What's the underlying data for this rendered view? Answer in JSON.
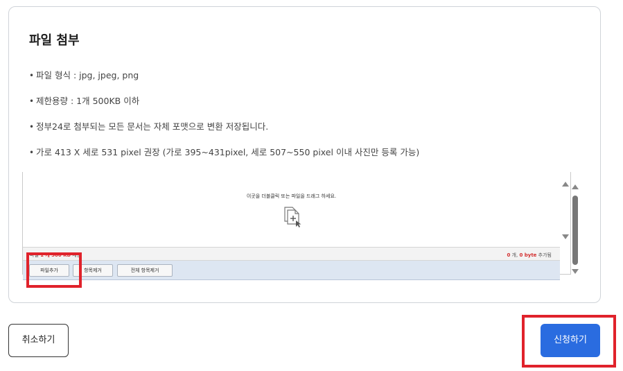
{
  "section": {
    "title": "파일 첨부",
    "notes": [
      "파일 형식 : jpg, jpeg, png",
      "제한용량 : 1개 500KB 이하",
      "정부24로 첨부되는 모든 문서는 자체 포맷으로 변환 저장됩니다.",
      "가로 413 X 세로 531 pixel 권장 (가로 395~431pixel, 세로 507~550 pixel 이내 사진만 등록 가능)"
    ],
    "bullet_char": "•"
  },
  "uploader": {
    "drop_hint": "이곳을 더블클릭 또는 파일을 드래그 하세요.",
    "status_left_prefix": "파일",
    "status_left_count": "1 개",
    "status_left_size": "500 KB",
    "status_left_suffix": "제한",
    "status_right_count": "0",
    "status_right_count_unit": "개,",
    "status_right_size": "0 byte",
    "status_right_suffix": "추가됨",
    "buttons": {
      "add_file": "파일추가",
      "remove_item": "항목제거",
      "remove_all": "전체 항목제거"
    }
  },
  "actions": {
    "cancel": "취소하기",
    "submit": "신청하기"
  },
  "colors": {
    "primary": "#2a6ce0",
    "highlight": "#e0222b",
    "status_red": "#d32f2f"
  }
}
